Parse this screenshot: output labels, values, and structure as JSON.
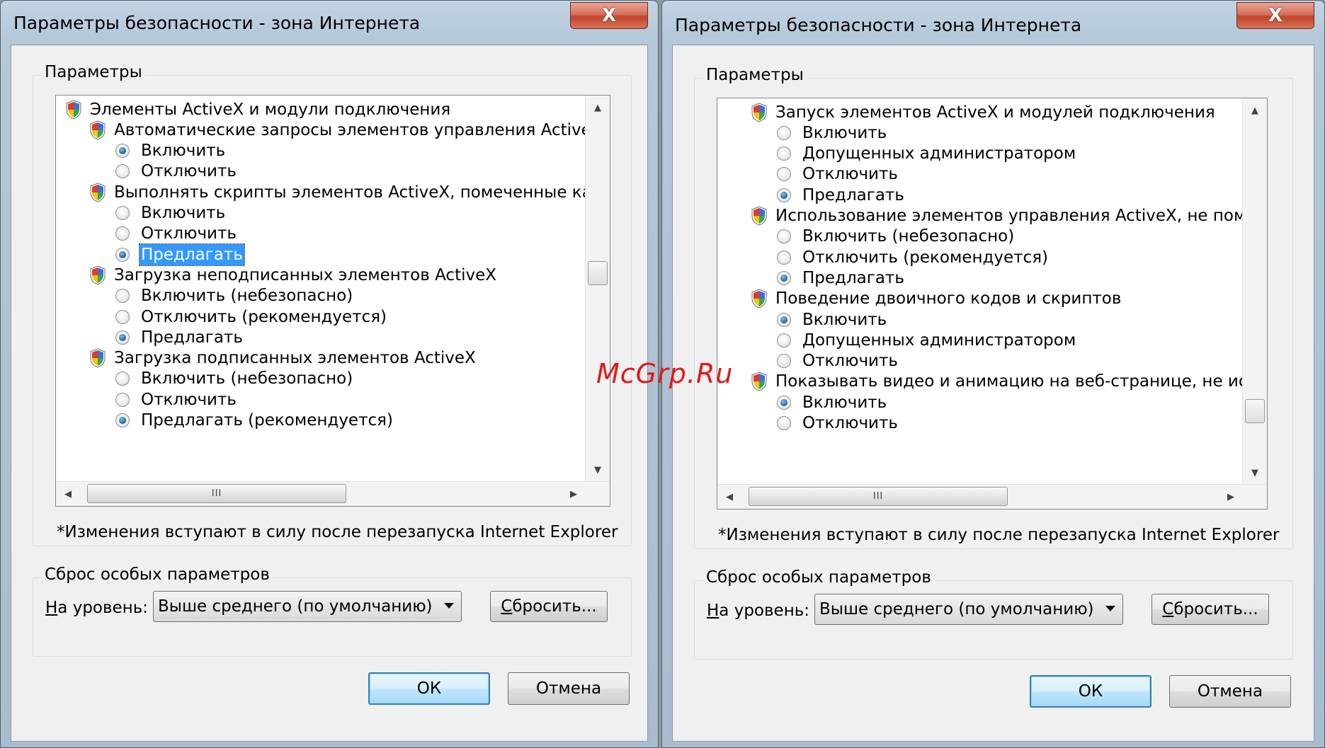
{
  "windows": [
    {
      "title": "Параметры безопасности - зона Интернета",
      "close_label": "X",
      "params_group_label": "Параметры",
      "tree_rows": [
        {
          "kind": "header",
          "indent": 0,
          "text": "Элементы ActiveX и модули подключения"
        },
        {
          "kind": "header",
          "indent": 1,
          "text": "Автоматические запросы элементов управления ActiveX"
        },
        {
          "kind": "option",
          "indent": 2,
          "text": "Включить",
          "checked": true
        },
        {
          "kind": "option",
          "indent": 2,
          "text": "Отключить",
          "checked": false
        },
        {
          "kind": "header",
          "indent": 1,
          "text": "Выполнять скрипты элементов ActiveX, помеченные как б"
        },
        {
          "kind": "option",
          "indent": 2,
          "text": "Включить",
          "checked": false
        },
        {
          "kind": "option",
          "indent": 2,
          "text": "Отключить",
          "checked": false
        },
        {
          "kind": "option",
          "indent": 2,
          "text": "Предлагать",
          "checked": true,
          "selected": true
        },
        {
          "kind": "header",
          "indent": 1,
          "text": "Загрузка неподписанных элементов ActiveX"
        },
        {
          "kind": "option",
          "indent": 2,
          "text": "Включить (небезопасно)",
          "checked": false
        },
        {
          "kind": "option",
          "indent": 2,
          "text": "Отключить (рекомендуется)",
          "checked": false
        },
        {
          "kind": "option",
          "indent": 2,
          "text": "Предлагать",
          "checked": true
        },
        {
          "kind": "header",
          "indent": 1,
          "text": "Загрузка подписанных элементов ActiveX"
        },
        {
          "kind": "option",
          "indent": 2,
          "text": "Включить (небезопасно)",
          "checked": false
        },
        {
          "kind": "option",
          "indent": 2,
          "text": "Отключить",
          "checked": false
        },
        {
          "kind": "option",
          "indent": 2,
          "text": "Предлагать (рекомендуется)",
          "checked": true
        }
      ],
      "vscroll_position": 0.45,
      "note": "*Изменения вступают в силу после перезапуска Internet Explorer",
      "reset_group_label": "Сброс особых параметров",
      "level_label_u": "Н",
      "level_label_rest": "а уровень:",
      "level_value": "Выше среднего (по умолчанию)",
      "reset_button_u": "С",
      "reset_button_rest": "бросить...",
      "ok_label": "ОК",
      "cancel_label": "Отмена"
    },
    {
      "title": "Параметры безопасности - зона Интернета",
      "close_label": "X",
      "params_group_label": "Параметры",
      "tree_rows": [
        {
          "kind": "header",
          "indent": 1,
          "text": "Запуск элементов ActiveX и модулей подключения"
        },
        {
          "kind": "option",
          "indent": 2,
          "text": "Включить",
          "checked": false
        },
        {
          "kind": "option",
          "indent": 2,
          "text": "Допущенных администратором",
          "checked": false
        },
        {
          "kind": "option",
          "indent": 2,
          "text": "Отключить",
          "checked": false
        },
        {
          "kind": "option",
          "indent": 2,
          "text": "Предлагать",
          "checked": true
        },
        {
          "kind": "header",
          "indent": 1,
          "text": "Использование элементов управления ActiveX, не помече"
        },
        {
          "kind": "option",
          "indent": 2,
          "text": "Включить (небезопасно)",
          "checked": false
        },
        {
          "kind": "option",
          "indent": 2,
          "text": "Отключить (рекомендуется)",
          "checked": false
        },
        {
          "kind": "option",
          "indent": 2,
          "text": "Предлагать",
          "checked": true
        },
        {
          "kind": "header",
          "indent": 1,
          "text": "Поведение двоичного кодов и скриптов"
        },
        {
          "kind": "option",
          "indent": 2,
          "text": "Включить",
          "checked": true
        },
        {
          "kind": "option",
          "indent": 2,
          "text": "Допущенных администратором",
          "checked": false
        },
        {
          "kind": "option",
          "indent": 2,
          "text": "Отключить",
          "checked": false
        },
        {
          "kind": "header",
          "indent": 1,
          "text": "Показывать видео и анимацию на веб-странице, не испо"
        },
        {
          "kind": "option",
          "indent": 2,
          "text": "Включить",
          "checked": true
        },
        {
          "kind": "option",
          "indent": 2,
          "text": "Отключить",
          "checked": false
        }
      ],
      "vscroll_position": 0.88,
      "note": "*Изменения вступают в силу после перезапуска Internet Explorer",
      "reset_group_label": "Сброс особых параметров",
      "level_label_u": "Н",
      "level_label_rest": "а уровень:",
      "level_value": "Выше среднего (по умолчанию)",
      "reset_button_u": "С",
      "reset_button_rest": "бросить...",
      "ok_label": "ОК",
      "cancel_label": "Отмена"
    }
  ],
  "scroll_icons": {
    "up": "▲",
    "down": "▼",
    "left": "◀",
    "right": "▶",
    "grip": "III"
  },
  "watermark": "McGrp.Ru",
  "colors": {
    "selection": "#3399ff",
    "watermark": "#e01a1a",
    "close_button": "#c2452b"
  }
}
